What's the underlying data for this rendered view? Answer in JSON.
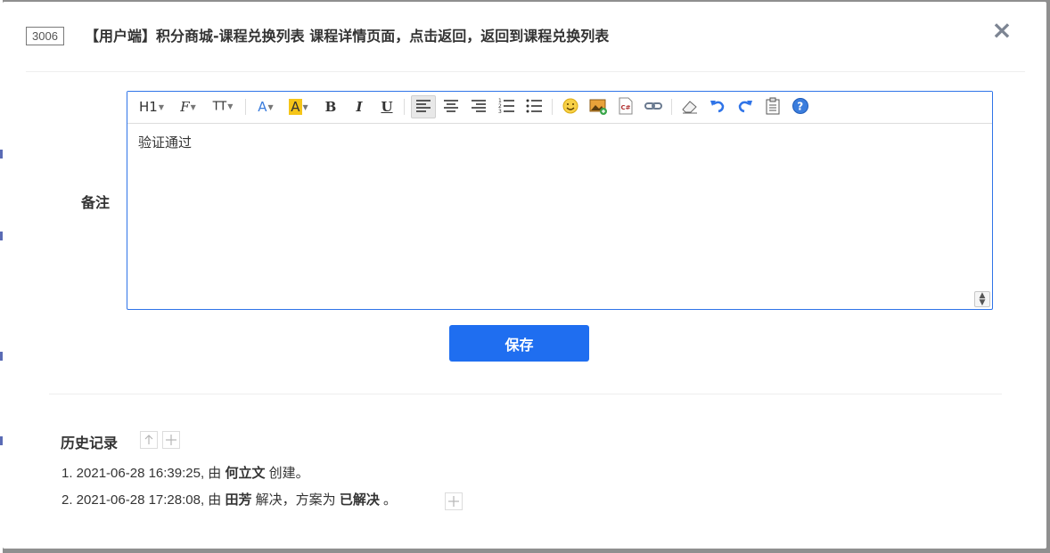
{
  "dialog": {
    "id_badge": "3006",
    "title": "【用户端】积分商城-课程兑换列表 课程详情页面，点击返回，返回到课程兑换列表",
    "close_icon": "×"
  },
  "form": {
    "note_label": "备注",
    "editor_content": "验证通过",
    "save_label": "保存"
  },
  "toolbar": {
    "heading": "H1",
    "font_family": "F",
    "font_size": "TT",
    "font_color": "A",
    "highlight": "A",
    "bold": "B",
    "italic": "I",
    "underline": "U",
    "icons": [
      "heading-icon",
      "font-family-icon",
      "font-size-icon",
      "font-color-icon",
      "highlight-color-icon",
      "bold-icon",
      "italic-icon",
      "underline-icon",
      "align-left-icon",
      "align-center-icon",
      "align-right-icon",
      "ordered-list-icon",
      "unordered-list-icon",
      "emoji-icon",
      "image-icon",
      "code-icon",
      "link-icon",
      "eraser-icon",
      "undo-icon",
      "redo-icon",
      "paste-icon",
      "help-icon"
    ]
  },
  "history": {
    "title": "历史记录",
    "entries": [
      {
        "prefix": "1. 2021-06-28 16:39:25, 由 ",
        "user": "何立文",
        "action": " 创建。"
      },
      {
        "prefix": "2. 2021-06-28 17:28:08, 由 ",
        "user": "田芳",
        "action": " 解决，方案为 ",
        "result": "已解决",
        "suffix": " 。"
      }
    ]
  },
  "colors": {
    "primary": "#1f6ef0",
    "editor_border": "#2f74e8",
    "highlight_yellow": "#f5c518",
    "link_blue": "#3b7ddd"
  }
}
